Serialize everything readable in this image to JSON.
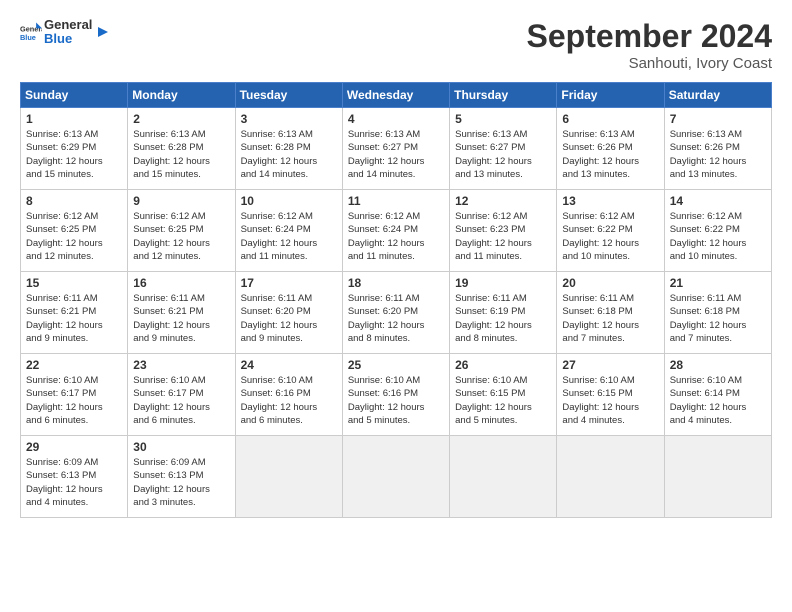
{
  "header": {
    "logo_general": "General",
    "logo_blue": "Blue",
    "month_title": "September 2024",
    "location": "Sanhouti, Ivory Coast"
  },
  "weekdays": [
    "Sunday",
    "Monday",
    "Tuesday",
    "Wednesday",
    "Thursday",
    "Friday",
    "Saturday"
  ],
  "weeks": [
    [
      {
        "day": "1",
        "lines": [
          "Sunrise: 6:13 AM",
          "Sunset: 6:29 PM",
          "Daylight: 12 hours",
          "and 15 minutes."
        ]
      },
      {
        "day": "2",
        "lines": [
          "Sunrise: 6:13 AM",
          "Sunset: 6:28 PM",
          "Daylight: 12 hours",
          "and 15 minutes."
        ]
      },
      {
        "day": "3",
        "lines": [
          "Sunrise: 6:13 AM",
          "Sunset: 6:28 PM",
          "Daylight: 12 hours",
          "and 14 minutes."
        ]
      },
      {
        "day": "4",
        "lines": [
          "Sunrise: 6:13 AM",
          "Sunset: 6:27 PM",
          "Daylight: 12 hours",
          "and 14 minutes."
        ]
      },
      {
        "day": "5",
        "lines": [
          "Sunrise: 6:13 AM",
          "Sunset: 6:27 PM",
          "Daylight: 12 hours",
          "and 13 minutes."
        ]
      },
      {
        "day": "6",
        "lines": [
          "Sunrise: 6:13 AM",
          "Sunset: 6:26 PM",
          "Daylight: 12 hours",
          "and 13 minutes."
        ]
      },
      {
        "day": "7",
        "lines": [
          "Sunrise: 6:13 AM",
          "Sunset: 6:26 PM",
          "Daylight: 12 hours",
          "and 13 minutes."
        ]
      }
    ],
    [
      {
        "day": "8",
        "lines": [
          "Sunrise: 6:12 AM",
          "Sunset: 6:25 PM",
          "Daylight: 12 hours",
          "and 12 minutes."
        ]
      },
      {
        "day": "9",
        "lines": [
          "Sunrise: 6:12 AM",
          "Sunset: 6:25 PM",
          "Daylight: 12 hours",
          "and 12 minutes."
        ]
      },
      {
        "day": "10",
        "lines": [
          "Sunrise: 6:12 AM",
          "Sunset: 6:24 PM",
          "Daylight: 12 hours",
          "and 11 minutes."
        ]
      },
      {
        "day": "11",
        "lines": [
          "Sunrise: 6:12 AM",
          "Sunset: 6:24 PM",
          "Daylight: 12 hours",
          "and 11 minutes."
        ]
      },
      {
        "day": "12",
        "lines": [
          "Sunrise: 6:12 AM",
          "Sunset: 6:23 PM",
          "Daylight: 12 hours",
          "and 11 minutes."
        ]
      },
      {
        "day": "13",
        "lines": [
          "Sunrise: 6:12 AM",
          "Sunset: 6:22 PM",
          "Daylight: 12 hours",
          "and 10 minutes."
        ]
      },
      {
        "day": "14",
        "lines": [
          "Sunrise: 6:12 AM",
          "Sunset: 6:22 PM",
          "Daylight: 12 hours",
          "and 10 minutes."
        ]
      }
    ],
    [
      {
        "day": "15",
        "lines": [
          "Sunrise: 6:11 AM",
          "Sunset: 6:21 PM",
          "Daylight: 12 hours",
          "and 9 minutes."
        ]
      },
      {
        "day": "16",
        "lines": [
          "Sunrise: 6:11 AM",
          "Sunset: 6:21 PM",
          "Daylight: 12 hours",
          "and 9 minutes."
        ]
      },
      {
        "day": "17",
        "lines": [
          "Sunrise: 6:11 AM",
          "Sunset: 6:20 PM",
          "Daylight: 12 hours",
          "and 9 minutes."
        ]
      },
      {
        "day": "18",
        "lines": [
          "Sunrise: 6:11 AM",
          "Sunset: 6:20 PM",
          "Daylight: 12 hours",
          "and 8 minutes."
        ]
      },
      {
        "day": "19",
        "lines": [
          "Sunrise: 6:11 AM",
          "Sunset: 6:19 PM",
          "Daylight: 12 hours",
          "and 8 minutes."
        ]
      },
      {
        "day": "20",
        "lines": [
          "Sunrise: 6:11 AM",
          "Sunset: 6:18 PM",
          "Daylight: 12 hours",
          "and 7 minutes."
        ]
      },
      {
        "day": "21",
        "lines": [
          "Sunrise: 6:11 AM",
          "Sunset: 6:18 PM",
          "Daylight: 12 hours",
          "and 7 minutes."
        ]
      }
    ],
    [
      {
        "day": "22",
        "lines": [
          "Sunrise: 6:10 AM",
          "Sunset: 6:17 PM",
          "Daylight: 12 hours",
          "and 6 minutes."
        ]
      },
      {
        "day": "23",
        "lines": [
          "Sunrise: 6:10 AM",
          "Sunset: 6:17 PM",
          "Daylight: 12 hours",
          "and 6 minutes."
        ]
      },
      {
        "day": "24",
        "lines": [
          "Sunrise: 6:10 AM",
          "Sunset: 6:16 PM",
          "Daylight: 12 hours",
          "and 6 minutes."
        ]
      },
      {
        "day": "25",
        "lines": [
          "Sunrise: 6:10 AM",
          "Sunset: 6:16 PM",
          "Daylight: 12 hours",
          "and 5 minutes."
        ]
      },
      {
        "day": "26",
        "lines": [
          "Sunrise: 6:10 AM",
          "Sunset: 6:15 PM",
          "Daylight: 12 hours",
          "and 5 minutes."
        ]
      },
      {
        "day": "27",
        "lines": [
          "Sunrise: 6:10 AM",
          "Sunset: 6:15 PM",
          "Daylight: 12 hours",
          "and 4 minutes."
        ]
      },
      {
        "day": "28",
        "lines": [
          "Sunrise: 6:10 AM",
          "Sunset: 6:14 PM",
          "Daylight: 12 hours",
          "and 4 minutes."
        ]
      }
    ],
    [
      {
        "day": "29",
        "lines": [
          "Sunrise: 6:09 AM",
          "Sunset: 6:13 PM",
          "Daylight: 12 hours",
          "and 4 minutes."
        ]
      },
      {
        "day": "30",
        "lines": [
          "Sunrise: 6:09 AM",
          "Sunset: 6:13 PM",
          "Daylight: 12 hours",
          "and 3 minutes."
        ]
      },
      {
        "day": "",
        "lines": []
      },
      {
        "day": "",
        "lines": []
      },
      {
        "day": "",
        "lines": []
      },
      {
        "day": "",
        "lines": []
      },
      {
        "day": "",
        "lines": []
      }
    ]
  ]
}
